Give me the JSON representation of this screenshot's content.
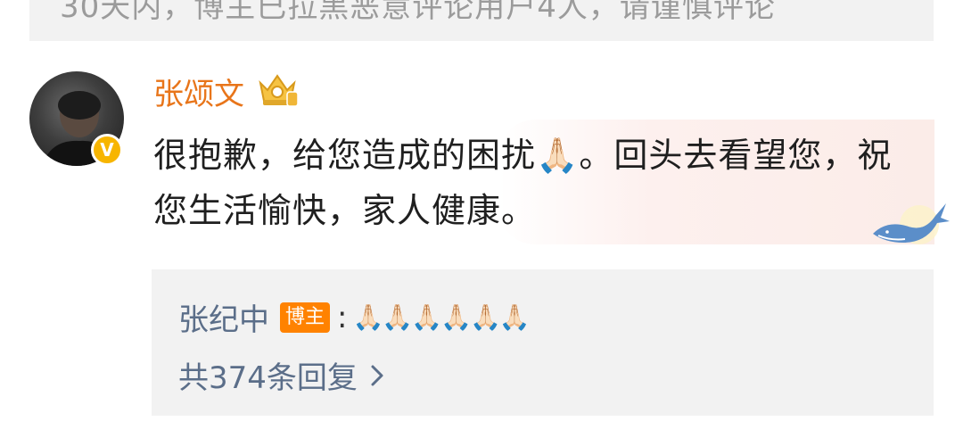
{
  "notice": {
    "text": "30天内，博主已拉黑恶意评论用户4人，请谨慎评论"
  },
  "comment": {
    "author": "张颂文",
    "verified_badge": "V",
    "fan_badge_icon": "crown-fan-badge-icon",
    "text": "很抱歉，给您造成的困扰🙏🏻。回头去看望您，祝您生活愉快，家人健康。",
    "decoration_icon": "whale-icon"
  },
  "reply": {
    "author": "张纪中",
    "author_tag": "博主",
    "separator": ":",
    "text": "🙏🏻🙏🏻🙏🏻🙏🏻🙏🏻🙏🏻",
    "count_label": "共374条回复",
    "chevron_icon": "chevron-right-icon"
  },
  "colors": {
    "username": "#e8751a",
    "reply_link": "#5b6e89",
    "author_tag_bg": "#ff8200",
    "verified_badge_bg": "#f7b500"
  }
}
